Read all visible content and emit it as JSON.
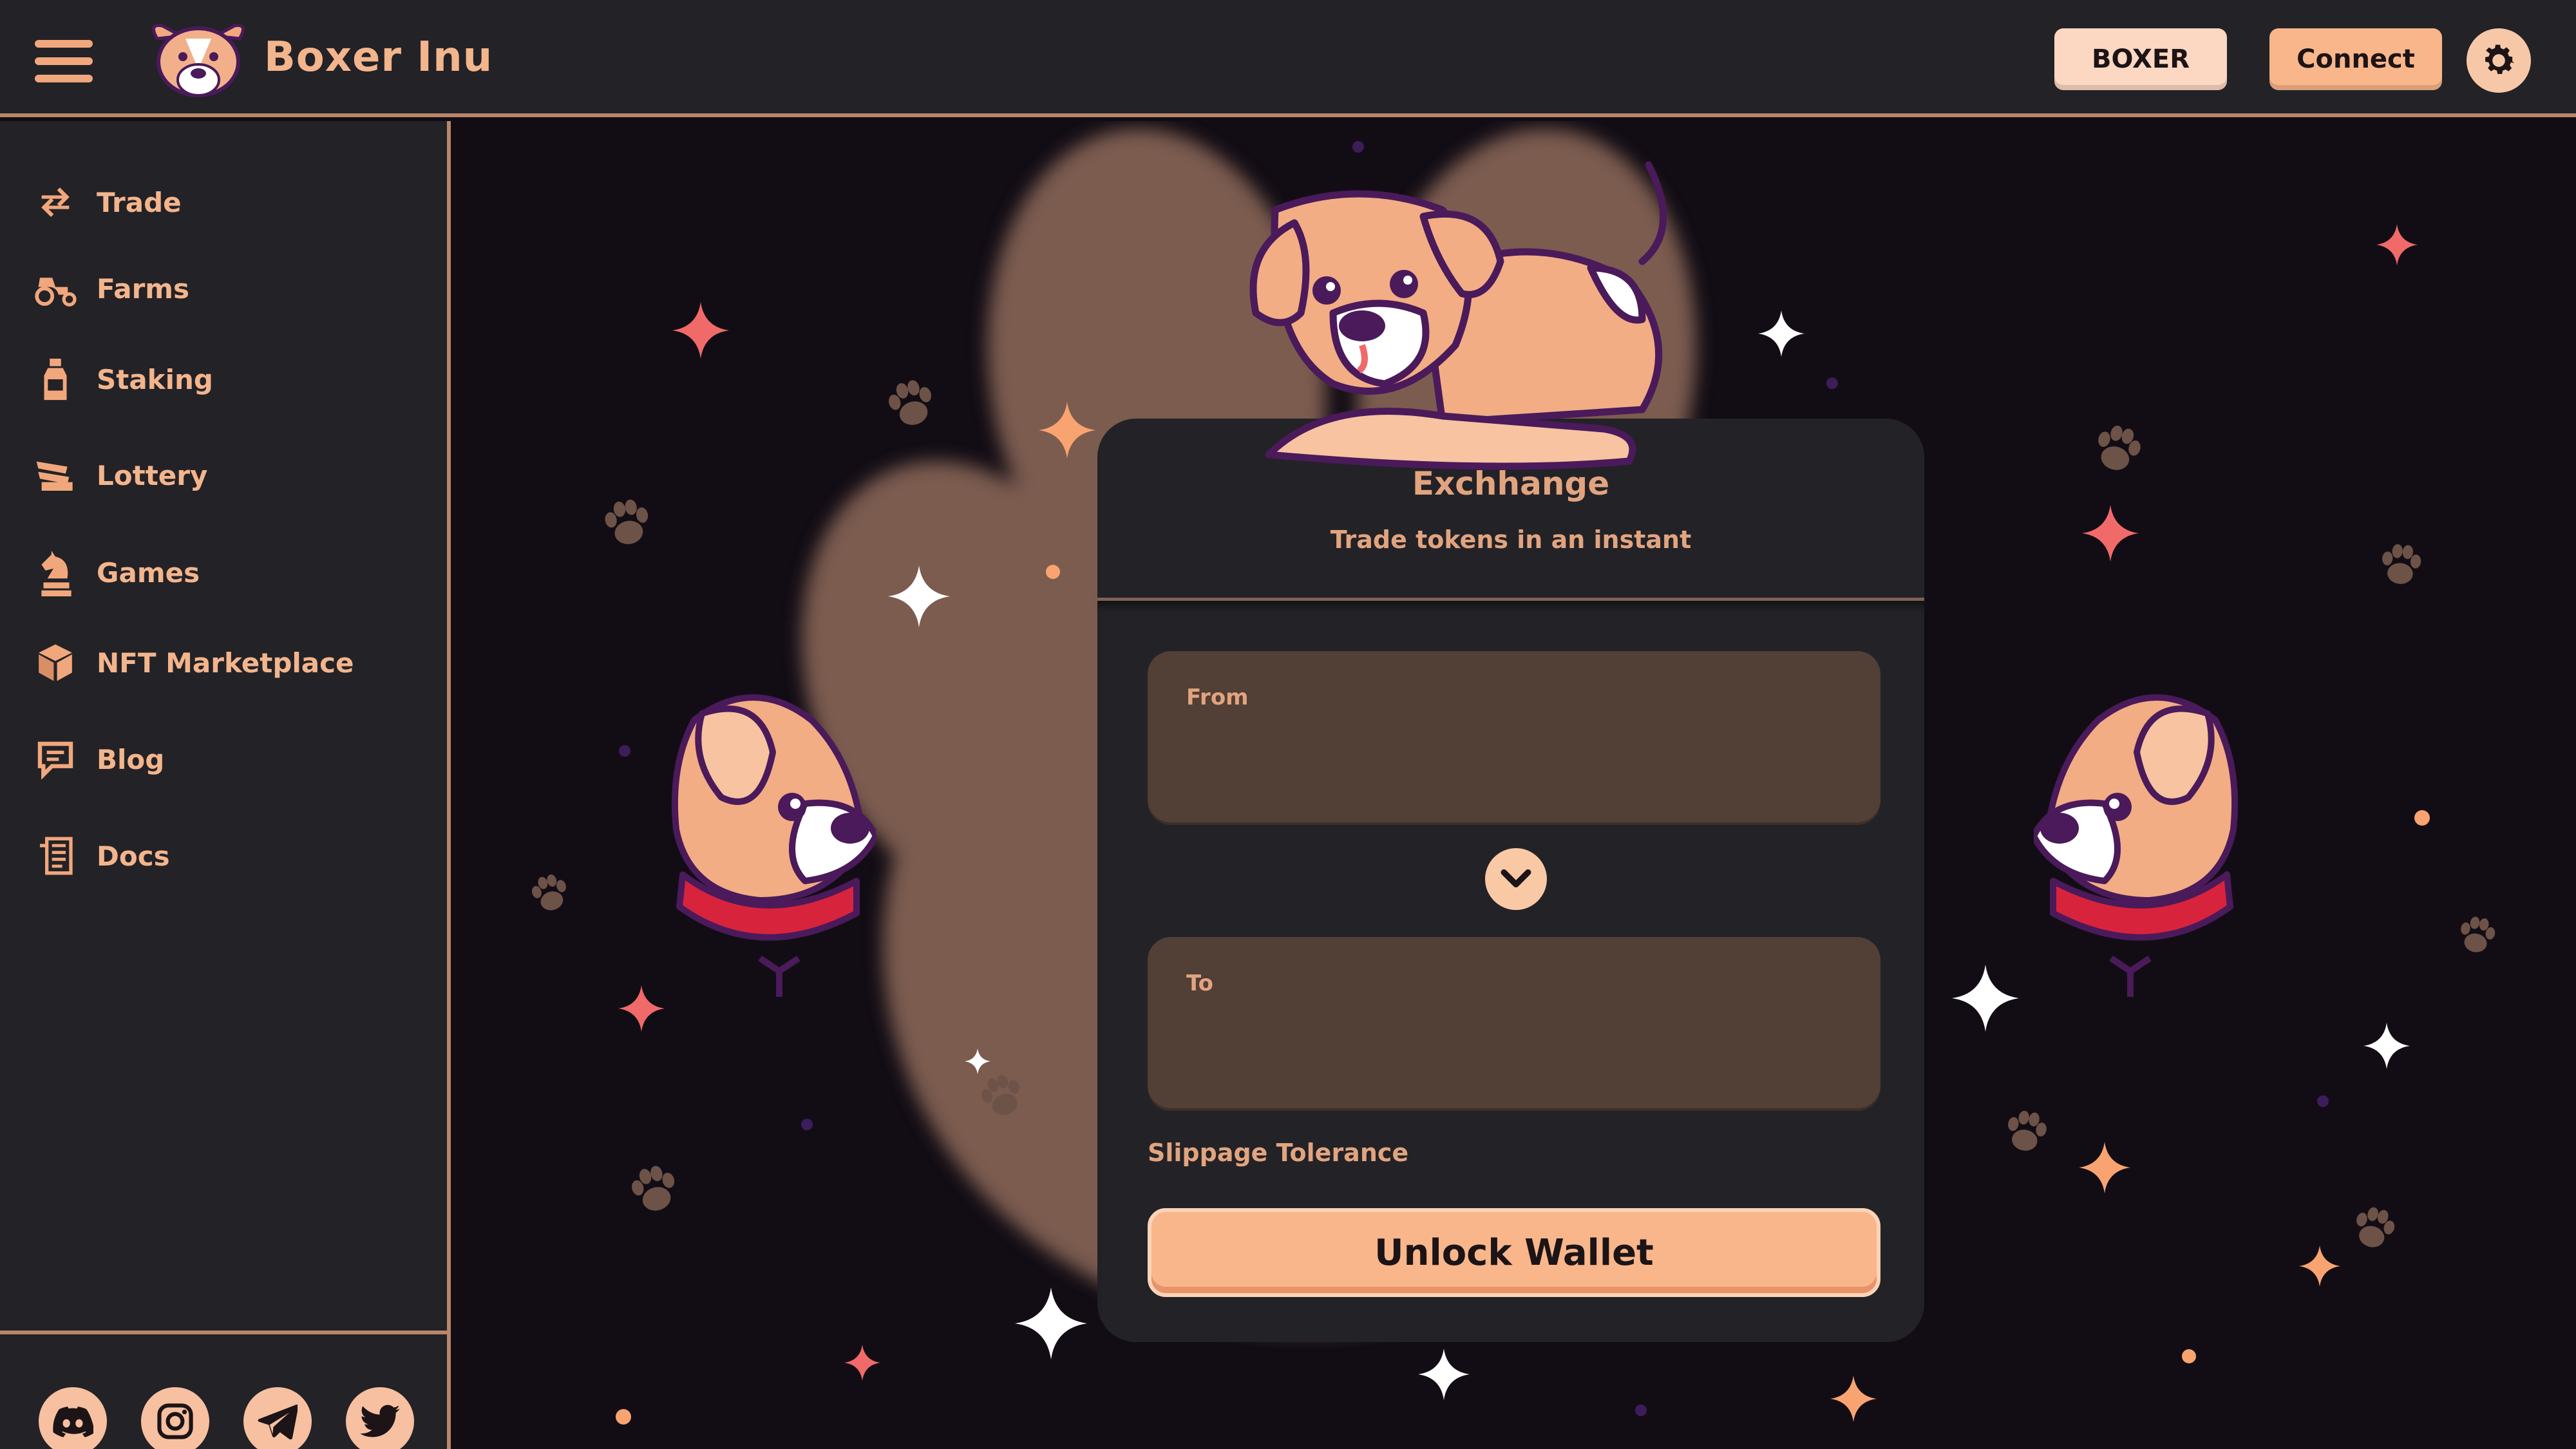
{
  "header": {
    "brand": "Boxer Inu",
    "boxer_label": "BOXER",
    "connect_label": "Connect"
  },
  "sidebar": {
    "items": [
      {
        "label": "Trade",
        "icon": "swap-arrows-icon"
      },
      {
        "label": "Farms",
        "icon": "tractor-icon"
      },
      {
        "label": "Staking",
        "icon": "bottle-icon"
      },
      {
        "label": "Lottery",
        "icon": "tickets-icon"
      },
      {
        "label": "Games",
        "icon": "chess-knight-icon"
      },
      {
        "label": "NFT Marketplace",
        "icon": "cube-icon"
      },
      {
        "label": "Blog",
        "icon": "chat-icon"
      },
      {
        "label": "Docs",
        "icon": "documents-icon"
      }
    ],
    "socials": [
      "discord-icon",
      "instagram-icon",
      "telegram-icon",
      "twitter-icon"
    ]
  },
  "exchange": {
    "title": "Exchhange",
    "subtitle": "Trade tokens in an instant",
    "from_label": "From",
    "to_label": "To",
    "slippage_label": "Slippage Tolerance",
    "unlock_label": "Unlock Wallet"
  },
  "colors": {
    "accent": "#f9b68b",
    "panel": "#232227",
    "background": "#120d15",
    "input": "#523f36",
    "border": "#b8866a"
  }
}
